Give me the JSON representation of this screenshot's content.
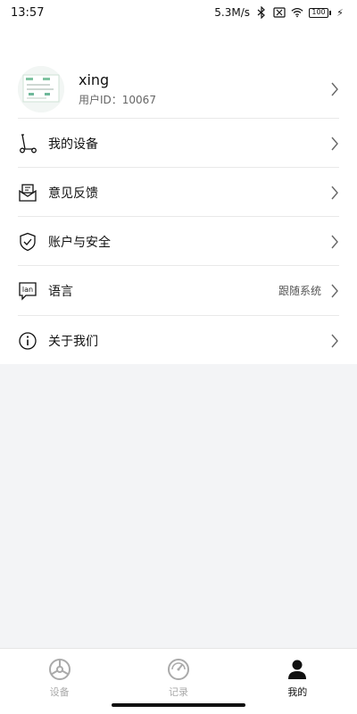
{
  "status_bar": {
    "time": "13:57",
    "network_speed": "5.3M/s",
    "battery": "100",
    "icons": [
      "bluetooth-icon",
      "sim-off-icon",
      "wifi-icon",
      "battery-icon",
      "charging-icon"
    ]
  },
  "profile": {
    "name": "xing",
    "user_id": "用户ID：10067"
  },
  "menu": {
    "items": [
      {
        "label": "我的设备",
        "icon": "scooter-icon"
      },
      {
        "label": "意见反馈",
        "icon": "feedback-mail-icon"
      },
      {
        "label": "账户与安全",
        "icon": "shield-check-icon"
      },
      {
        "label": "语言",
        "value": "跟随系统",
        "icon": "language-icon"
      },
      {
        "label": "关于我们",
        "icon": "info-icon"
      }
    ]
  },
  "tabbar": {
    "tabs": [
      {
        "label": "设备",
        "icon": "wheel-icon",
        "active": false
      },
      {
        "label": "记录",
        "icon": "speedometer-icon",
        "active": false
      },
      {
        "label": "我的",
        "icon": "user-icon",
        "active": true
      }
    ]
  },
  "colors": {
    "background": "#f3f4f6",
    "panel": "#ffffff",
    "text": "#111111",
    "muted": "#aaaaaa"
  }
}
